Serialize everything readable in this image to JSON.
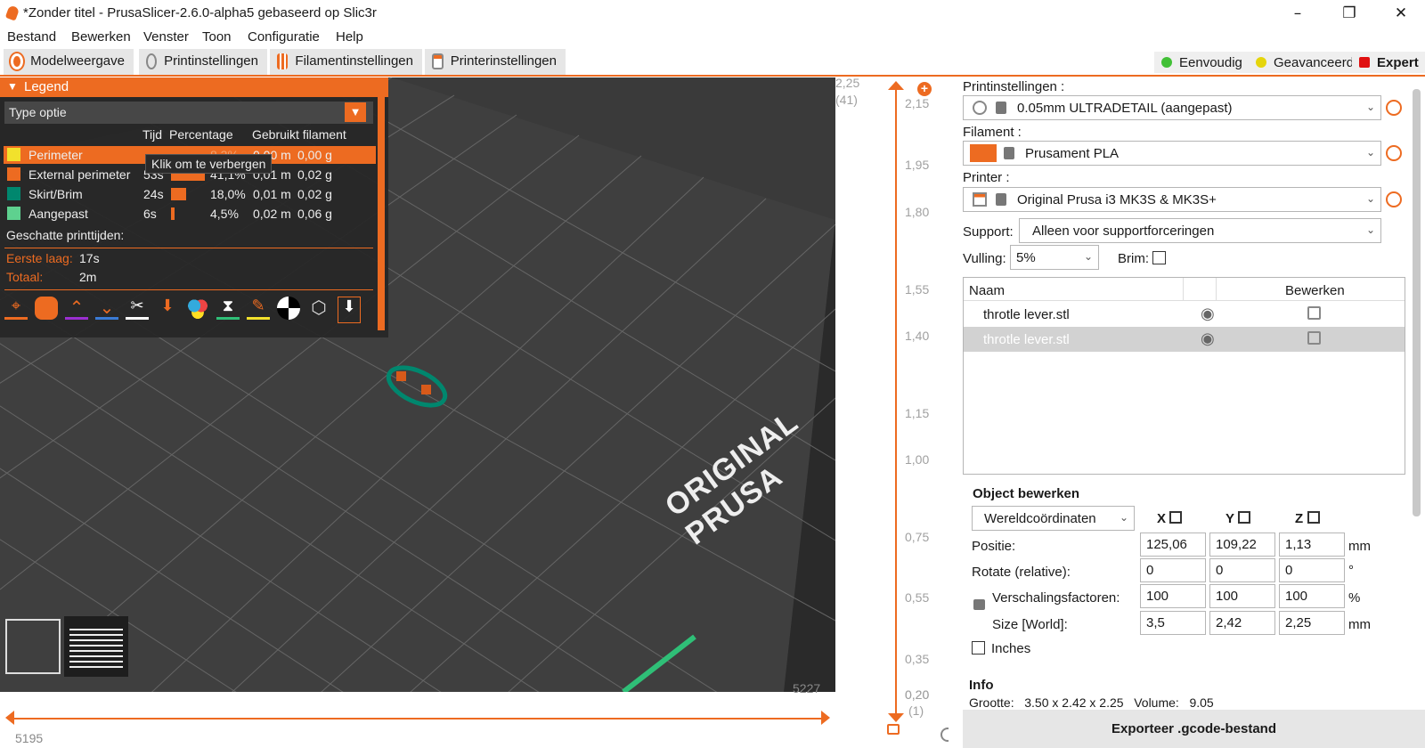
{
  "window": {
    "title": "*Zonder titel - PrusaSlicer-2.6.0-alpha5 gebaseerd op Slic3r"
  },
  "menu": [
    "Bestand",
    "Bewerken",
    "Venster",
    "Toon",
    "Configuratie",
    "Help"
  ],
  "tabs": [
    {
      "label": "Modelweergave"
    },
    {
      "label": "Printinstellingen"
    },
    {
      "label": "Filamentinstellingen"
    },
    {
      "label": "Printerinstellingen"
    }
  ],
  "modes": [
    {
      "label": "Eenvoudig",
      "color": "#41c036"
    },
    {
      "label": "Geavanceerd",
      "color": "#e5d50b"
    },
    {
      "label": "Expert",
      "color": "#e01010"
    }
  ],
  "legend": {
    "title": "Legend",
    "type_select": "Type optie",
    "columns": {
      "time": "Tijd",
      "percentage": "Percentage",
      "filament": "Gebruikt filament"
    },
    "rows": [
      {
        "name": "Perimeter",
        "color": "#f2e12c",
        "time": "",
        "percentage": "8,3%",
        "length": "0,00 m",
        "weight": "0,00 g",
        "selected": true
      },
      {
        "name": "External perimeter",
        "color": "#ed6b21",
        "time": "53s",
        "percentage": "41,1%",
        "length": "0,01 m",
        "weight": "0,02 g"
      },
      {
        "name": "Skirt/Brim",
        "color": "#00876e",
        "time": "24s",
        "percentage": "18,0%",
        "length": "0,01 m",
        "weight": "0,02 g"
      },
      {
        "name": "Aangepast",
        "color": "#5ed18f",
        "time": "6s",
        "percentage": "4,5%",
        "length": "0,02 m",
        "weight": "0,06 g"
      }
    ],
    "tooltip": "Klik om te verbergen",
    "estimated_label": "Geschatte printtijden:",
    "first_layer_label": "Eerste laag:",
    "first_layer_value": "17s",
    "total_label": "Totaal:",
    "total_value": "2m"
  },
  "viewport": {
    "bed_label": "ORIGINAL PRUSA"
  },
  "hslider": {
    "right_value": "5227",
    "left_value": "5195"
  },
  "vslider": {
    "top_value": "2,25",
    "top_layer": "(41)",
    "bottom_value": "0,20",
    "bottom_layer": "(1)",
    "ticks": [
      "2,15",
      "1,95",
      "1,80",
      "1,55",
      "1,40",
      "1,15",
      "1,00",
      "0,75",
      "0,55",
      "0,35",
      "0,20"
    ]
  },
  "right": {
    "print_settings_label": "Printinstellingen :",
    "print_settings_value": "0.05mm ULTRADETAIL (aangepast)",
    "filament_label": "Filament :",
    "filament_value": "Prusament PLA",
    "filament_color": "#ed6b21",
    "printer_label": "Printer :",
    "printer_value": "Original Prusa i3 MK3S & MK3S+",
    "support_label": "Support:",
    "support_value": "Alleen voor supportforceringen",
    "infill_label": "Vulling:",
    "infill_value": "5%",
    "brim_label": "Brim:",
    "list_headers": {
      "name": "Naam",
      "edit": "Bewerken"
    },
    "objects": [
      {
        "name": "throtle lever.stl"
      },
      {
        "name": "throtle lever.stl",
        "selected": true
      }
    ],
    "object_edit_title": "Object bewerken",
    "coord_system": "Wereldcoördinaten",
    "axes": {
      "x": "X",
      "y": "Y",
      "z": "Z"
    },
    "position_label": "Positie:",
    "position": [
      "125,06",
      "109,22",
      "1,13"
    ],
    "position_unit": "mm",
    "rotate_label": "Rotate (relative):",
    "rotate": [
      "0",
      "0",
      "0"
    ],
    "rotate_unit": "°",
    "scale_label": "Verschalingsfactoren:",
    "scale": [
      "100",
      "100",
      "100"
    ],
    "scale_unit": "%",
    "size_label": "Size [World]:",
    "size": [
      "3,5",
      "2,42",
      "2,25"
    ],
    "size_unit": "mm",
    "inches_label": "Inches",
    "info_title": "Info",
    "info_line": "Grootte:   3,50 x 2,42 x 2,25   Volume:   9,05",
    "export_label": "Exporteer .gcode-bestand"
  }
}
